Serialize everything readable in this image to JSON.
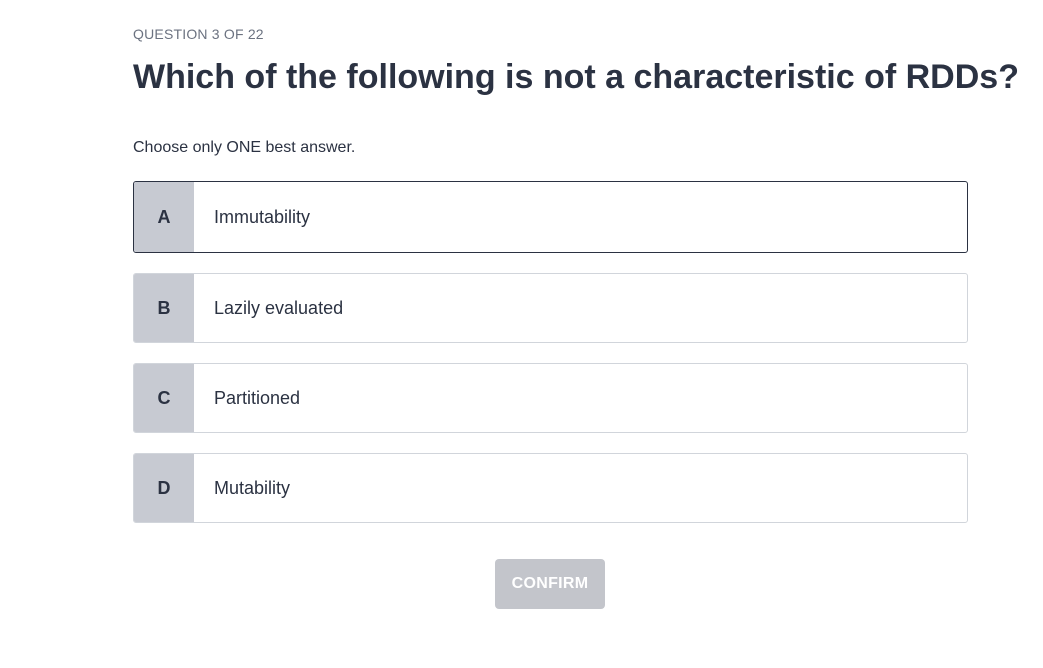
{
  "header": {
    "counter": "QUESTION 3 OF 22",
    "question": "Which of the following is not a characteristic of RDDs?",
    "instruction": "Choose only ONE best answer."
  },
  "options": [
    {
      "letter": "A",
      "text": "Immutability",
      "selected": true
    },
    {
      "letter": "B",
      "text": "Lazily evaluated",
      "selected": false
    },
    {
      "letter": "C",
      "text": "Partitioned",
      "selected": false
    },
    {
      "letter": "D",
      "text": "Mutability",
      "selected": false
    }
  ],
  "actions": {
    "confirm_label": "CONFIRM",
    "confirm_enabled": false
  },
  "colors": {
    "text": "#2b3242",
    "letter_bg": "#c7cad2",
    "border": "#d1d5db",
    "selected_border": "#2b3242",
    "confirm_disabled_bg": "#c3c5cb"
  }
}
